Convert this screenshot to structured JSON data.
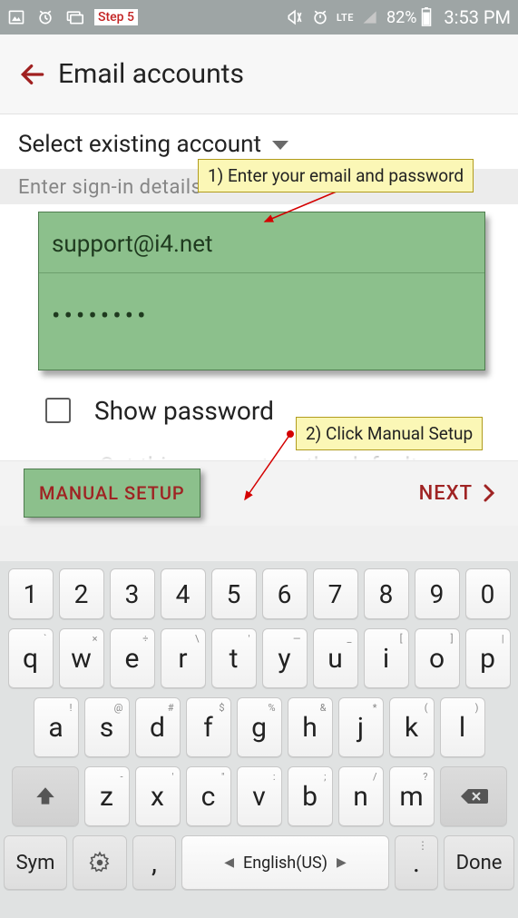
{
  "statusbar": {
    "step_label": "Step 5",
    "lte": "LTE",
    "battery_pct": "82%",
    "time": "3:53 PM"
  },
  "header": {
    "title": "Email accounts"
  },
  "select_label": "Select existing account",
  "section_label": "Enter sign-in details",
  "fields": {
    "email": "support@i4.net",
    "password_mask": "••••••••"
  },
  "show_password_label": "Show password",
  "default_text": "Set this account as the default",
  "actions": {
    "manual": "MANUAL SETUP",
    "next": "NEXT"
  },
  "annotations": {
    "a1": "1) Enter your email and password",
    "a2": "2) Click Manual Setup"
  },
  "keyboard": {
    "row1": [
      "1",
      "2",
      "3",
      "4",
      "5",
      "6",
      "7",
      "8",
      "9",
      "0"
    ],
    "row2": [
      {
        "k": "q",
        "s": "`"
      },
      {
        "k": "w",
        "s": "×"
      },
      {
        "k": "e",
        "s": "÷"
      },
      {
        "k": "r",
        "s": "\\"
      },
      {
        "k": "t",
        "s": "'"
      },
      {
        "k": "y",
        "s": "—"
      },
      {
        "k": "u",
        "s": "_"
      },
      {
        "k": "i",
        "s": "["
      },
      {
        "k": "o",
        "s": "]"
      },
      {
        "k": "p",
        "s": "|"
      }
    ],
    "row3": [
      {
        "k": "a",
        "s": "!"
      },
      {
        "k": "s",
        "s": "@"
      },
      {
        "k": "d",
        "s": "#"
      },
      {
        "k": "f",
        "s": "$"
      },
      {
        "k": "g",
        "s": "%"
      },
      {
        "k": "h",
        "s": "&"
      },
      {
        "k": "j",
        "s": "*"
      },
      {
        "k": "k",
        "s": "("
      },
      {
        "k": "l",
        "s": ")"
      }
    ],
    "row4": [
      {
        "k": "z",
        "s": "-"
      },
      {
        "k": "x",
        "s": "'"
      },
      {
        "k": "c",
        "s": "\""
      },
      {
        "k": "v",
        "s": ":"
      },
      {
        "k": "b",
        "s": ";"
      },
      {
        "k": "n",
        "s": "/"
      },
      {
        "k": "m",
        "s": "?"
      }
    ],
    "sym": "Sym",
    "space": "English(US)",
    "done": "Done"
  }
}
